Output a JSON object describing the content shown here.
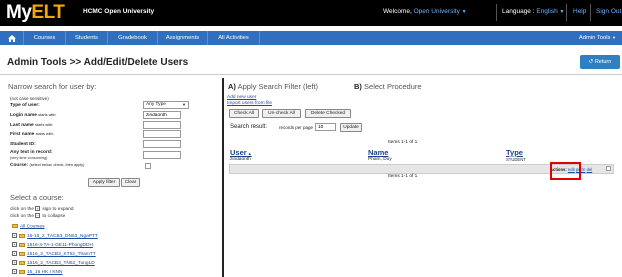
{
  "header": {
    "logo_my": "My",
    "logo_elt": "ELT",
    "org": "HCMC Open University",
    "welcome_label": "Welcome,",
    "welcome_user": "Open University",
    "language_label": "Language :",
    "language_value": "English",
    "help": "Help",
    "signout": "Sign Out"
  },
  "nav": {
    "items": [
      {
        "label": "Courses"
      },
      {
        "label": "Students"
      },
      {
        "label": "Gradebook"
      },
      {
        "label": "Assignments"
      },
      {
        "label": "All Activities"
      }
    ],
    "admin_tools": "Admin Tools"
  },
  "page": {
    "title": "Admin Tools >> Add/Edit/Delete Users",
    "return_label": "Return"
  },
  "left": {
    "narrow_title": "Narrow search for user by:",
    "not_case_sensitive": "(not case sensitive)",
    "type_label": "Type of user:",
    "type_value": "Any Type",
    "login_label": "Login name",
    "login_sub": "starts with:",
    "login_value": "zindaonth",
    "last_label": "Last name",
    "last_sub": "starts with:",
    "first_label": "First name",
    "first_sub": "starts with:",
    "student_id_label": "Student ID:",
    "any_text_label": "Any text in record:",
    "any_text_sub": "(very time consuming)",
    "course_label": "Course:",
    "course_sub": "(select below, check, then apply)",
    "apply_filter": "Apply filter",
    "clear": "Clear",
    "select_course_title": "Select a course:",
    "expand_hint_a": "click on the",
    "expand_hint_b": "sign to expand",
    "collapse_hint_a": "click on the",
    "collapse_hint_b": "to collapse",
    "all_courses": "All Courses",
    "courses": [
      "15-16_2_TACB3_DN53_NgaPTT",
      "1516-3-TA-1-GE11-PhongDDH",
      "1516_2_TACB3_KT52_ThamTT",
      "1516_2_TACB3_TN52_TungLD",
      "15_16 HK I KNN"
    ]
  },
  "right": {
    "step_a_letter": "A)",
    "step_a": "Apply Search Filter (left)",
    "step_b_letter": "B)",
    "step_b": "Select Procedure",
    "add_new_user": "Add new user",
    "import_users": "Import users from file",
    "check_all": "Check All",
    "uncheck_all": "Un-check All",
    "delete_checked": "Delete Checked",
    "search_result": "Search result:",
    "records_per_page": "records per page",
    "records_value": "10",
    "update": "Update",
    "items_top": "Items 1-1 of 1",
    "items_bottom": "Items 1-1 of 1",
    "columns": {
      "user": "User",
      "name": "Name",
      "type": "Type"
    },
    "row": {
      "user": "zindaonth",
      "name": "Pham, Duy",
      "type": "STUDENT"
    },
    "actions_label": "Actions:",
    "actions": {
      "edit": "edit",
      "perm": "perm",
      "del": "del"
    }
  }
}
